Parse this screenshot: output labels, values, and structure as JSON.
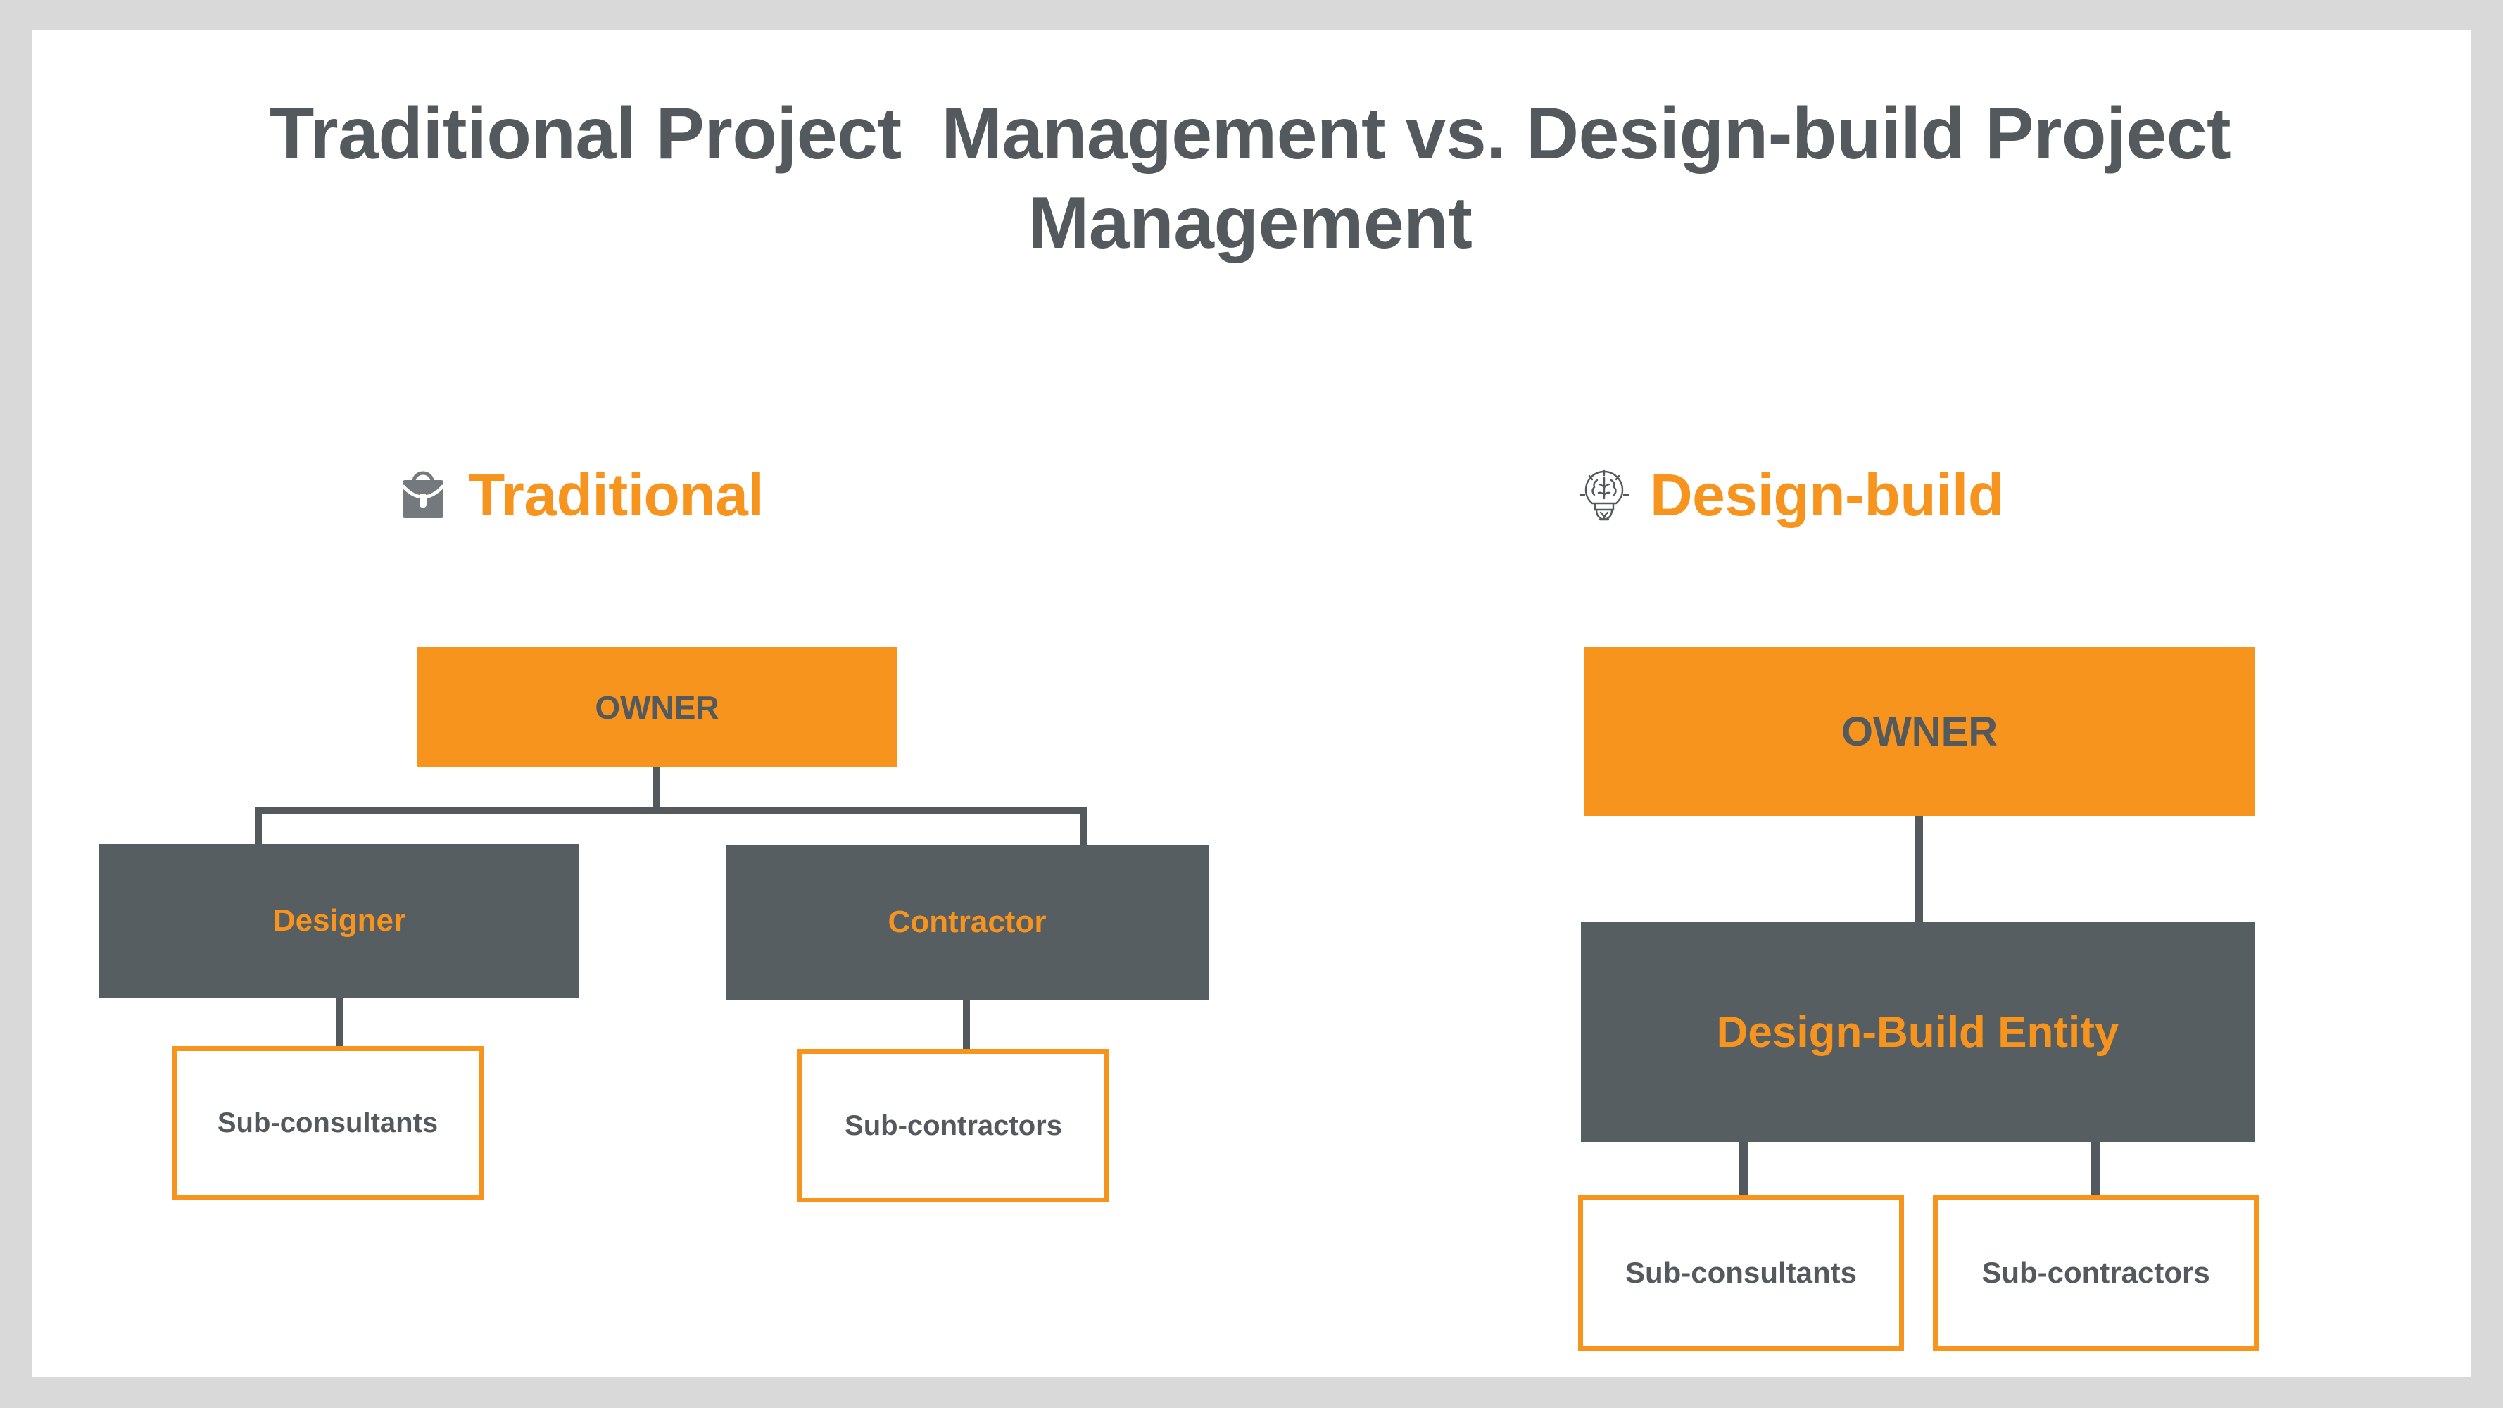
{
  "slide": {
    "title": "Traditional Project  Management vs. Design-build Project Management",
    "background_color": "#FFFFFF",
    "frame_color": "#D9D9D9"
  },
  "colors": {
    "orange": "#F7941E",
    "dark_gray": "#565E61",
    "title_gray": "#53595C",
    "white": "#FFFFFF"
  },
  "columns": {
    "traditional": {
      "heading": "Traditional",
      "icon": "briefcase-icon",
      "nodes": {
        "owner": "OWNER",
        "designer": "Designer",
        "contractor": "Contractor",
        "sub_consultants": "Sub-consultants",
        "sub_contractors": "Sub-contractors"
      }
    },
    "design_build": {
      "heading": "Design-build",
      "icon": "brain-lightbulb-icon",
      "nodes": {
        "owner": "OWNER",
        "entity": "Design-Build Entity",
        "sub_consultants": "Sub-consultants",
        "sub_contractors": "Sub-contractors"
      }
    }
  },
  "chart_data": {
    "type": "diagram",
    "title": "Traditional Project  Management vs. Design-build Project Management",
    "diagrams": [
      {
        "name": "Traditional",
        "icon": "briefcase-icon",
        "nodes": [
          {
            "id": "owner",
            "label": "OWNER",
            "level": 0,
            "fill": "#F7941E",
            "text_color": "#53595C"
          },
          {
            "id": "designer",
            "label": "Designer",
            "level": 1,
            "fill": "#565E61",
            "text_color": "#F7941E"
          },
          {
            "id": "contractor",
            "label": "Contractor",
            "level": 1,
            "fill": "#565E61",
            "text_color": "#F7941E"
          },
          {
            "id": "sub-consultants",
            "label": "Sub-consultants",
            "level": 2,
            "fill": "#FFFFFF",
            "border": "#F7941E",
            "text_color": "#53595C"
          },
          {
            "id": "sub-contractors",
            "label": "Sub-contractors",
            "level": 2,
            "fill": "#FFFFFF",
            "border": "#F7941E",
            "text_color": "#53595C"
          }
        ],
        "edges": [
          {
            "from": "owner",
            "to": "designer"
          },
          {
            "from": "owner",
            "to": "contractor"
          },
          {
            "from": "designer",
            "to": "sub-consultants"
          },
          {
            "from": "contractor",
            "to": "sub-contractors"
          }
        ]
      },
      {
        "name": "Design-build",
        "icon": "brain-lightbulb-icon",
        "nodes": [
          {
            "id": "owner",
            "label": "OWNER",
            "level": 0,
            "fill": "#F7941E",
            "text_color": "#53595C"
          },
          {
            "id": "design-build-entity",
            "label": "Design-Build Entity",
            "level": 1,
            "fill": "#565E61",
            "text_color": "#F7941E"
          },
          {
            "id": "sub-consultants",
            "label": "Sub-consultants",
            "level": 2,
            "fill": "#FFFFFF",
            "border": "#F7941E",
            "text_color": "#53595C"
          },
          {
            "id": "sub-contractors",
            "label": "Sub-contractors",
            "level": 2,
            "fill": "#FFFFFF",
            "border": "#F7941E",
            "text_color": "#53595C"
          }
        ],
        "edges": [
          {
            "from": "owner",
            "to": "design-build-entity"
          },
          {
            "from": "design-build-entity",
            "to": "sub-consultants"
          },
          {
            "from": "design-build-entity",
            "to": "sub-contractors"
          }
        ]
      }
    ]
  }
}
